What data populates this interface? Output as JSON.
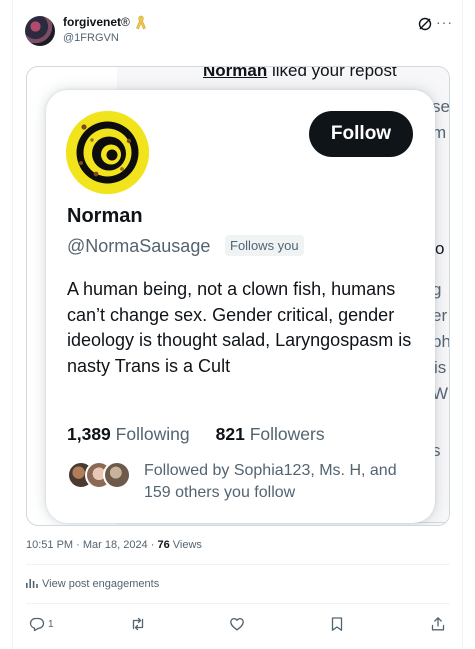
{
  "author": {
    "display_name": "forgivenet",
    "registered_mark": "®",
    "handle": "@1FRGVN"
  },
  "embedded_screenshot": {
    "background_header": "liked your repost",
    "background_header_name": "Norman",
    "background_fragments": [
      "se",
      "m",
      "o",
      "g",
      "er",
      "ph",
      "is",
      "W",
      "s"
    ],
    "profile_card": {
      "name": "Norman",
      "handle": "@NormaSausage",
      "follows_you_badge": "Follows you",
      "follow_button": "Follow",
      "bio": "A human being, not a clown fish, humans can’t change sex. Gender critical, gender ideology is thought salad, Laryngospasm is nasty Trans is a Cult",
      "following_count": "1,389",
      "following_label": "Following",
      "followers_count": "821",
      "followers_label": "Followers",
      "mutuals_text": "Followed by Sophia123, Ms. H, and 159 others you follow"
    }
  },
  "meta": {
    "time_date": "10:51 PM · Mar 18, 2024",
    "separator": " · ",
    "views_count": "76",
    "views_label": "Views"
  },
  "engagements_link": "View post engagements",
  "actions": {
    "reply_count": "1"
  },
  "icons": [
    "ribbon-icon",
    "grok-icon",
    "more-icon",
    "engagements-icon",
    "reply-icon",
    "repost-icon",
    "like-icon",
    "bookmark-icon",
    "share-icon"
  ],
  "colors": {
    "text_primary": "#0f1419",
    "text_secondary": "#536471",
    "divider": "#eff3f4",
    "card_avatar_yellow": "#f2e41c"
  }
}
